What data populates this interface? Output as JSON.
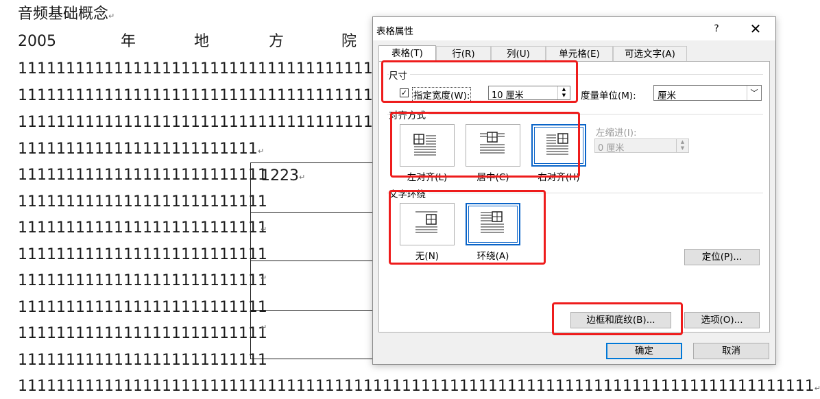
{
  "document": {
    "title": "音频基础概念",
    "year_row": [
      "2005",
      "年",
      "地",
      "方",
      "院"
    ],
    "long_line_visible": "111111111111111111111111111111111111111",
    "short_line": "1111111111111111111111111",
    "side_lines": [
      "11111111111111111111111111",
      "11111111111111111111111111",
      "11111111111111111111111111",
      "11111111111111111111111111",
      "11111111111111111111111111",
      "11111111111111111111111111",
      "11111111111111111111111111",
      "11111111111111111111111111"
    ],
    "bottom_line": "11111111111111111111111111111111111111111111111111111111111111111111111111111111111",
    "table_cells": [
      "1223",
      "",
      "",
      ""
    ]
  },
  "dialog": {
    "title": "表格属性",
    "help": "?",
    "close": "✕",
    "tabs": [
      "表格(T)",
      "行(R)",
      "列(U)",
      "单元格(E)",
      "可选文字(A)"
    ],
    "size": {
      "group": "尺寸",
      "checkbox_checked": true,
      "checkbox_label": "指定宽度(W):",
      "width_value": "10 厘米",
      "unit_label": "度量单位(M):",
      "unit_value": "厘米"
    },
    "alignment": {
      "group": "对齐方式",
      "options": [
        "左对齐(L)",
        "居中(C)",
        "右对齐(H)"
      ],
      "selected": "右对齐(H)",
      "indent_label": "左缩进(I):",
      "indent_value": "0 厘米"
    },
    "wrap": {
      "group": "文字环绕",
      "options": [
        "无(N)",
        "环绕(A)"
      ],
      "selected": "环绕(A)",
      "position_button": "定位(P)..."
    },
    "borders_button": "边框和底纹(B)...",
    "options_button": "选项(O)...",
    "ok": "确定",
    "cancel": "取消"
  },
  "colors": {
    "highlight": "#ee1c1c",
    "selected_border": "#0a64c8"
  }
}
